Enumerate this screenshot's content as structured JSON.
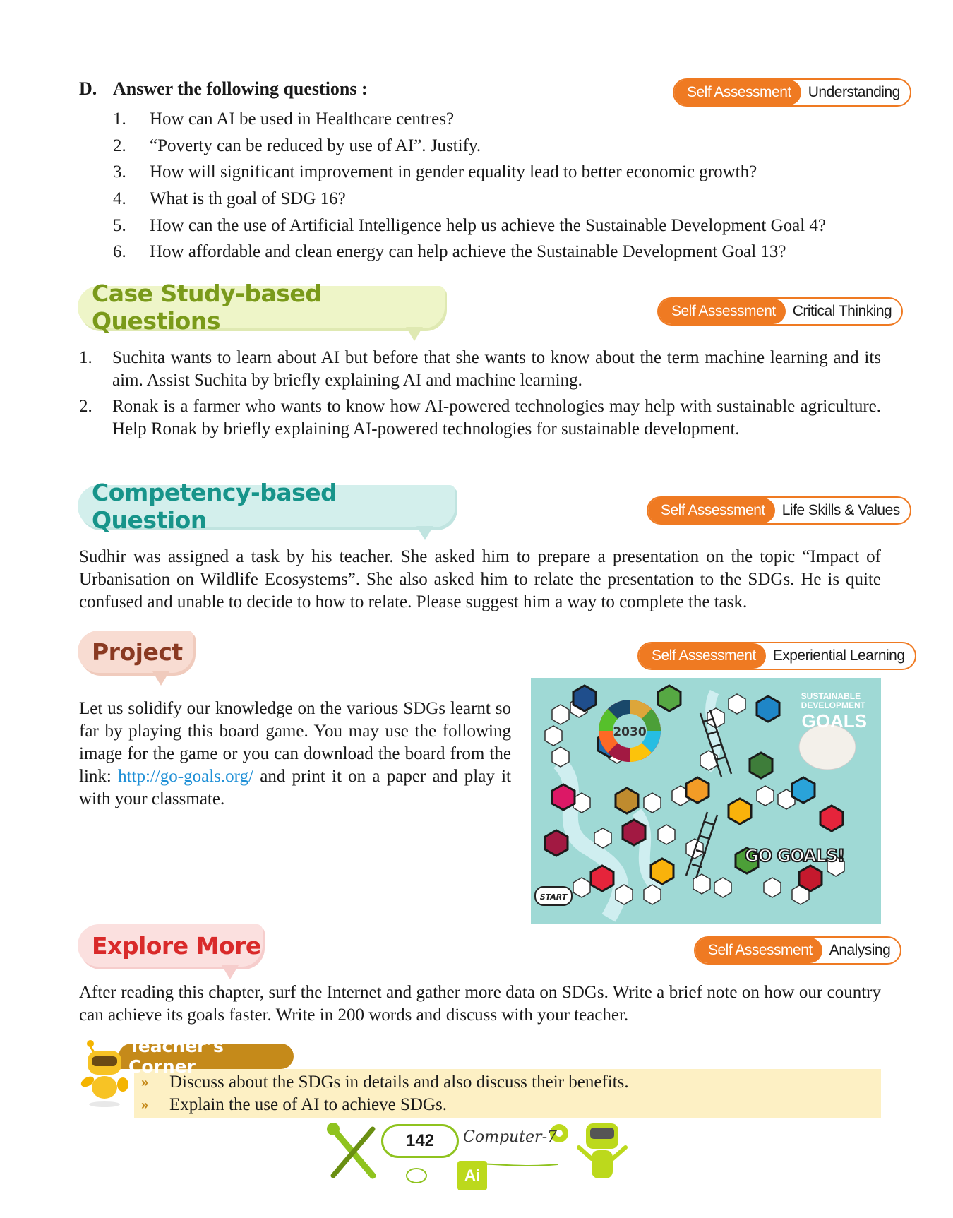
{
  "section_d": {
    "letter": "D.",
    "heading": "Answer the following questions :",
    "assessment": {
      "label": "Self Assessment",
      "skill": "Understanding"
    },
    "questions": [
      {
        "num": "1.",
        "text": "How can AI be used in Healthcare centres?"
      },
      {
        "num": "2.",
        "text": "“Poverty can be reduced by use of AI”. Justify."
      },
      {
        "num": "3.",
        "text": "How will significant improvement in gender equality lead to better economic growth?"
      },
      {
        "num": "4.",
        "text": "What is th goal of SDG 16?"
      },
      {
        "num": "5.",
        "text": "How can the use of Artificial Intelligence help us achieve the Sustainable Development Goal 4?"
      },
      {
        "num": "6.",
        "text": "How affordable and clean energy can help achieve the Sustainable Development Goal 13?"
      }
    ]
  },
  "case_study": {
    "title": "Case Study-based Questions",
    "assessment": {
      "label": "Self Assessment",
      "skill": "Critical Thinking"
    },
    "items": [
      {
        "num": "1.",
        "text": "Suchita wants to learn about AI but before that she wants to know about the term machine learning and its aim. Assist Suchita  by briefly explaining AI and machine learning."
      },
      {
        "num": "2.",
        "text": "Ronak is a farmer who wants to know how AI-powered  technologies may help with sustainable agriculture. Help Ronak by briefly explaining AI-powered technologies for sustainable development."
      }
    ]
  },
  "competency": {
    "title": "Competency-based Question",
    "assessment": {
      "label": "Self Assessment",
      "skill": "Life Skills & Values"
    },
    "text": "Sudhir was assigned a task by his teacher. She asked him to prepare a presentation on the topic “Impact of Urbanisation on Wildlife Ecosystems”. She also asked him to relate the presentation to the SDGs. He is quite confused and unable to decide to how to relate. Please suggest him a way to complete the task."
  },
  "project": {
    "title": "Project",
    "assessment": {
      "label": "Self Assessment",
      "skill": "Experiential Learning"
    },
    "text_before": "Let us solidify our knowledge on the various SDGs learnt so far by playing this board game. You may use the following image for the game or you can download the board from the link: ",
    "link": "http://go-goals.org/",
    "text_after": " and print it on a paper and play it with your classmate.",
    "board": {
      "title_line1": "SUSTAINABLE",
      "title_line2": "DEVELOPMENT",
      "title_goals": "GOALS",
      "game_name": "GO GOALS!",
      "start_label": "START",
      "year": "2030"
    }
  },
  "explore": {
    "title": "Explore More",
    "assessment": {
      "label": "Self Assessment",
      "skill": "Analysing"
    },
    "text": "After reading this chapter, surf the Internet and gather more data on SDGs. Write a brief note on how our country can achieve its goals faster. Write in 200 words and discuss with your teacher."
  },
  "teachers_corner": {
    "title": "Teacher’s Corner",
    "bullet": "»",
    "items": [
      "Discuss about the SDGs in details and also discuss their benefits.",
      "Explain the use of AI to achieve SDGs."
    ]
  },
  "footer": {
    "page_number": "142",
    "book_title": "Computer-7",
    "chip_label": "Ai"
  },
  "colors": {
    "accent_orange": "#ef7a22",
    "case_green": "#7a9a1a",
    "competency_teal": "#17948a",
    "project_brown": "#8a3a22",
    "explore_red": "#d92a2a",
    "link_blue": "#1e8fd6",
    "board_bg": "#9fd9d5"
  }
}
